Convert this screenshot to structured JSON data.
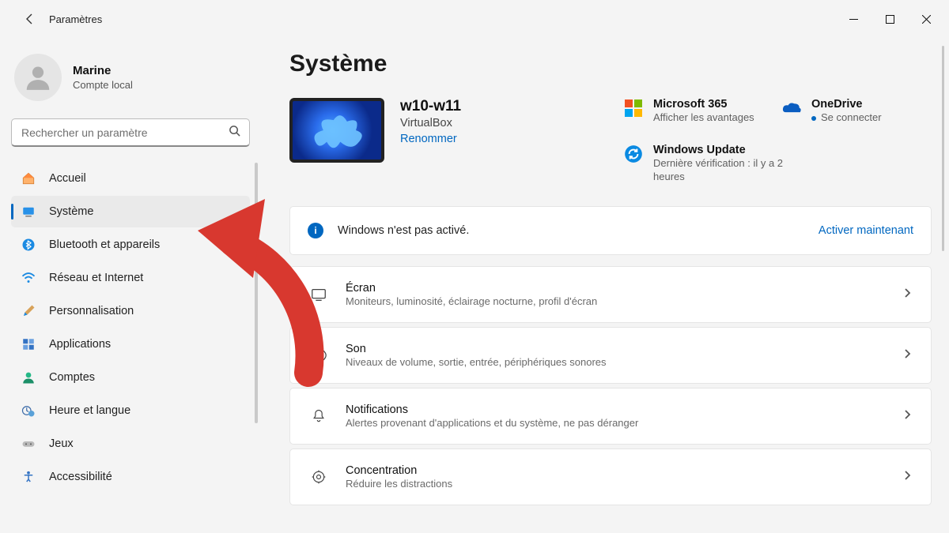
{
  "window": {
    "app_title": "Paramètres"
  },
  "user": {
    "name": "Marine",
    "subtitle": "Compte local"
  },
  "search": {
    "placeholder": "Rechercher un paramètre"
  },
  "sidebar": {
    "items": [
      {
        "id": "home",
        "label": "Accueil"
      },
      {
        "id": "system",
        "label": "Système",
        "selected": true
      },
      {
        "id": "bluetooth",
        "label": "Bluetooth et appareils"
      },
      {
        "id": "network",
        "label": "Réseau et Internet"
      },
      {
        "id": "personalization",
        "label": "Personnalisation"
      },
      {
        "id": "apps",
        "label": "Applications"
      },
      {
        "id": "accounts",
        "label": "Comptes"
      },
      {
        "id": "time",
        "label": "Heure et langue"
      },
      {
        "id": "gaming",
        "label": "Jeux"
      },
      {
        "id": "accessibility",
        "label": "Accessibilité"
      }
    ]
  },
  "page": {
    "title": "Système",
    "device": {
      "name": "w10-w11",
      "model": "VirtualBox",
      "rename_link": "Renommer"
    },
    "info_tiles": {
      "m365": {
        "title": "Microsoft 365",
        "subtitle": "Afficher les avantages"
      },
      "onedrive": {
        "title": "OneDrive",
        "subtitle": "Se connecter"
      },
      "update": {
        "title": "Windows Update",
        "subtitle": "Dernière vérification : il y a 2 heures"
      }
    },
    "activation": {
      "message": "Windows n'est pas activé.",
      "action": "Activer maintenant"
    },
    "settings": [
      {
        "id": "display",
        "title": "Écran",
        "subtitle": "Moniteurs, luminosité, éclairage nocturne, profil d'écran"
      },
      {
        "id": "sound",
        "title": "Son",
        "subtitle": "Niveaux de volume, sortie, entrée, périphériques sonores"
      },
      {
        "id": "notifications",
        "title": "Notifications",
        "subtitle": "Alertes provenant d'applications et du système, ne pas déranger"
      },
      {
        "id": "focus",
        "title": "Concentration",
        "subtitle": "Réduire les distractions"
      }
    ]
  }
}
